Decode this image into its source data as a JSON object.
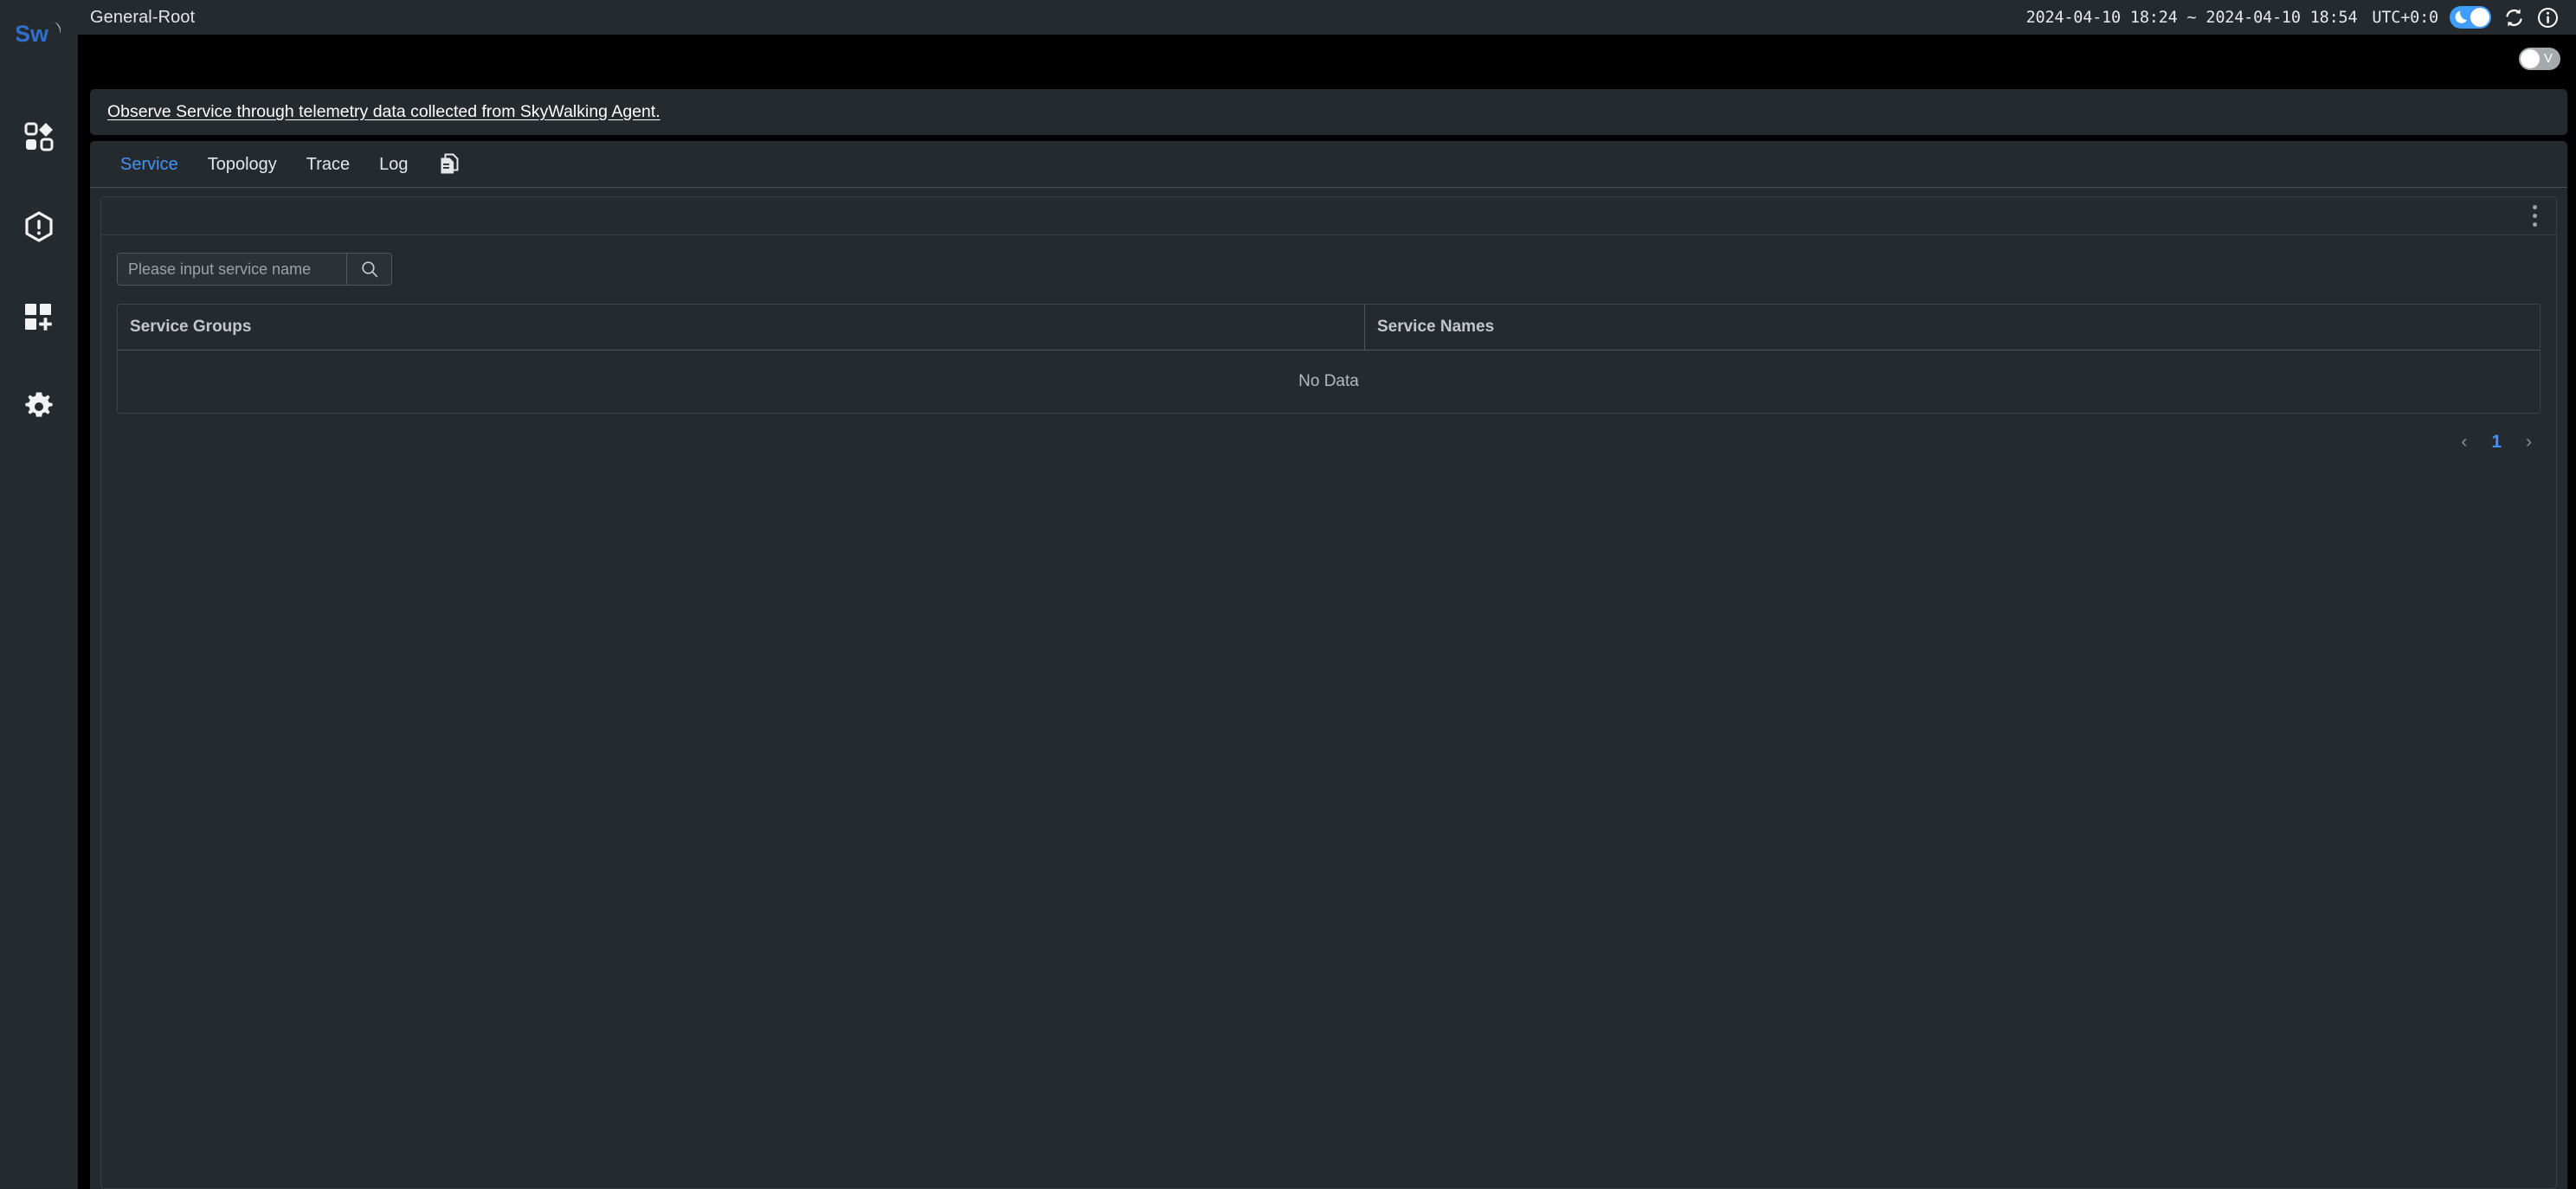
{
  "app": {
    "logo_alt": "skywalking-logo",
    "title": "General-Root"
  },
  "header": {
    "time_range": "2024-04-10 18:24 ~ 2024-04-10 18:54",
    "timezone": "UTC+0:0",
    "dark_mode_icon": "moon-icon",
    "refresh_icon": "refresh-icon",
    "info_icon": "info-icon",
    "accent_color": "#409eff"
  },
  "subbar": {
    "view_toggle_label": "V",
    "view_toggle_color": "#a6a9ad"
  },
  "sidebar": {
    "items": [
      {
        "name": "sidebar-item-dashboard",
        "icon": "dashboard-grid-icon"
      },
      {
        "name": "sidebar-item-alerts",
        "icon": "alert-hexagon-icon"
      },
      {
        "name": "sidebar-item-new-dashboard",
        "icon": "add-grid-icon"
      },
      {
        "name": "sidebar-item-settings",
        "icon": "gear-icon"
      }
    ]
  },
  "banner": {
    "text": "Observe Service through telemetry data collected from SkyWalking Agent."
  },
  "tabs": [
    {
      "label": "Service",
      "active": true
    },
    {
      "label": "Topology",
      "active": false
    },
    {
      "label": "Trace",
      "active": false
    },
    {
      "label": "Log",
      "active": false
    }
  ],
  "tabs_extra": {
    "copy_icon": "copy-documents-icon"
  },
  "widget": {
    "menu_icon": "more-vertical-icon"
  },
  "search": {
    "placeholder": "Please input service name",
    "value": "",
    "button_icon": "search-icon"
  },
  "table": {
    "columns": [
      "Service Groups",
      "Service Names"
    ],
    "rows": [],
    "empty_text": "No Data"
  },
  "pagination": {
    "prev_icon": "chevron-left-icon",
    "next_icon": "chevron-right-icon",
    "current_page": "1",
    "active_color": "#4493f8"
  }
}
